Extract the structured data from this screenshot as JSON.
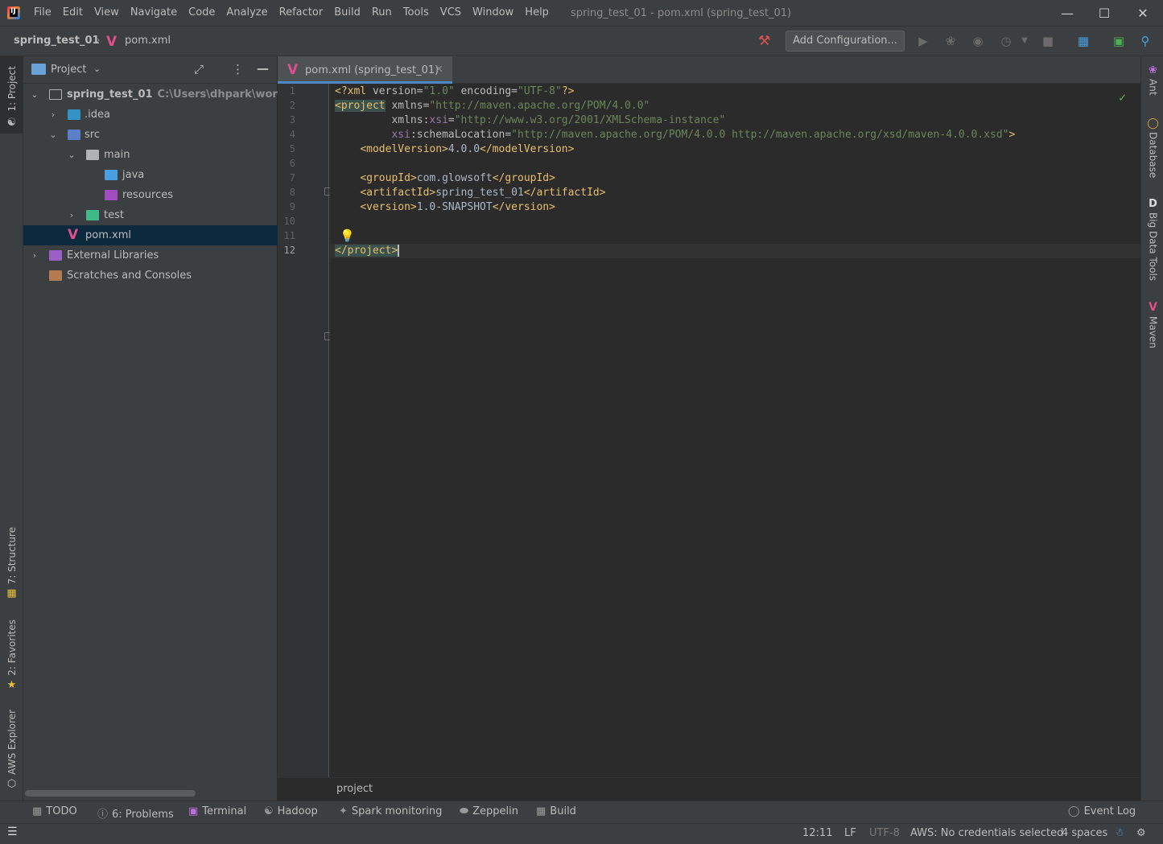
{
  "menu": {
    "file": "File",
    "edit": "Edit",
    "view": "View",
    "navigate": "Navigate",
    "code": "Code",
    "analyze": "Analyze",
    "refactor": "Refactor",
    "build": "Build",
    "run": "Run",
    "tools": "Tools",
    "vcs": "VCS",
    "window": "Window",
    "help": "Help"
  },
  "window_title": "spring_test_01 - pom.xml (spring_test_01)",
  "navbar": {
    "project": "spring_test_01",
    "file": "pom.xml",
    "add_configuration": "Add Configuration..."
  },
  "left_tabs": {
    "project": "1: Project",
    "structure": "7: Structure",
    "favorites": "2: Favorites",
    "aws": "AWS Explorer"
  },
  "right_tabs": {
    "ant": "Ant",
    "database": "Database",
    "bigdata": "Big Data Tools",
    "maven": "Maven"
  },
  "project_panel": {
    "title": "Project",
    "tree": [
      {
        "label": "spring_test_01",
        "path": "C:\\Users\\dhpark\\workspac"
      },
      {
        "label": ".idea"
      },
      {
        "label": "src"
      },
      {
        "label": "main"
      },
      {
        "label": "java"
      },
      {
        "label": "resources"
      },
      {
        "label": "test"
      },
      {
        "label": "pom.xml"
      },
      {
        "label": "External Libraries"
      },
      {
        "label": "Scratches and Consoles"
      }
    ]
  },
  "editor": {
    "tab_label": "pom.xml (spring_test_01)",
    "line_numbers": [
      "1",
      "2",
      "3",
      "4",
      "5",
      "6",
      "7",
      "8",
      "9",
      "10",
      "11",
      "12"
    ],
    "current_line": 12,
    "lines": {
      "l1": {
        "open": "<?xml",
        "a1": " version=",
        "v1": "\"1.0\"",
        "a2": " encoding=",
        "v2": "\"UTF-8\"",
        "close": "?>"
      },
      "l2": {
        "tag": "<project",
        "attr": " xmlns=",
        "val": "\"http://maven.apache.org/POM/4.0.0\""
      },
      "l3": {
        "indent": "         ",
        "attr": "xmlns:",
        "ns": "xsi",
        "eq": "=",
        "val": "\"http://www.w3.org/2001/XMLSchema-instance\""
      },
      "l4": {
        "indent": "         ",
        "ns": "xsi",
        "attr": ":schemaLocation=",
        "val": "\"http://maven.apache.org/POM/4.0.0 http://maven.apache.org/xsd/maven-4.0.0.xsd\"",
        "close": ">"
      },
      "l5": {
        "indent": "    ",
        "open": "<modelVersion>",
        "text": "4.0.0",
        "close": "</modelVersion>"
      },
      "l7": {
        "indent": "    ",
        "open": "<groupId>",
        "text": "com.glowsoft",
        "close": "</groupId>"
      },
      "l8": {
        "indent": "    ",
        "open": "<artifactId>",
        "text": "spring_test_01",
        "close": "</artifactId>"
      },
      "l9": {
        "indent": "    ",
        "open": "<version>",
        "text": "1.0-SNAPSHOT",
        "close": "</version>"
      },
      "l12": {
        "tag": "</project>"
      }
    },
    "breadcrumb": "project"
  },
  "bottom_tools": {
    "todo": "TODO",
    "problems": "6: Problems",
    "terminal": "Terminal",
    "hadoop": "Hadoop",
    "spark": "Spark monitoring",
    "zeppelin": "Zeppelin",
    "build": "Build",
    "event_log": "Event Log"
  },
  "status": {
    "position": "12:11",
    "line_sep": "LF",
    "encoding": "UTF-8",
    "aws": "AWS: No credentials selected",
    "indent": "4 spaces"
  },
  "colors": {
    "background": "#2b2b2b",
    "panel": "#3c3f41",
    "selection": "#0d293e",
    "tag": "#e8bf6a",
    "string": "#6a8759",
    "maven": "#e04e8c"
  }
}
